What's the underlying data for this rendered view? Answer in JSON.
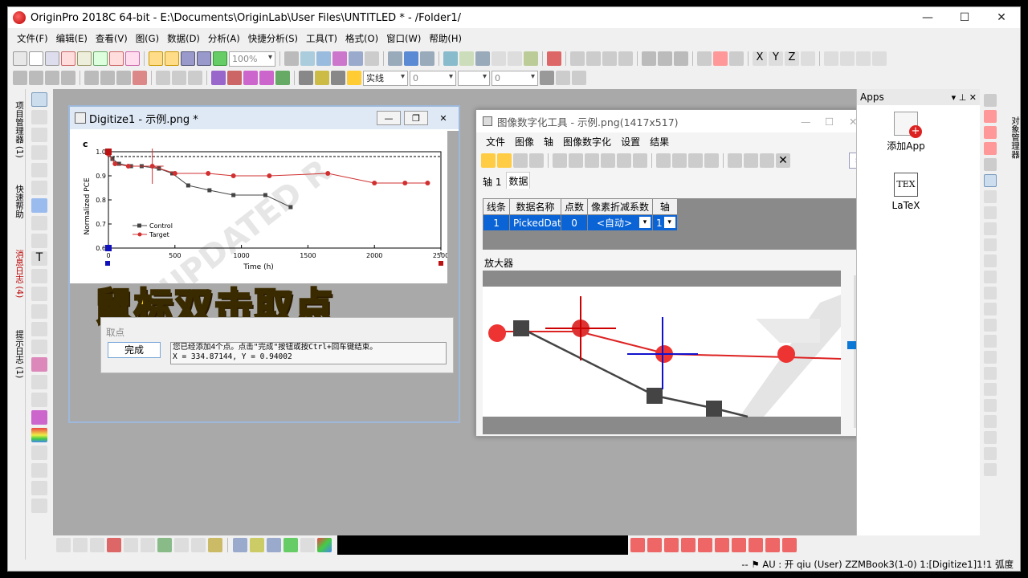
{
  "window": {
    "title": "OriginPro 2018C 64-bit - E:\\Documents\\OriginLab\\User Files\\UNTITLED * - /Folder1/",
    "minimize": "—",
    "maximize": "☐",
    "close": "✕"
  },
  "menu": [
    "文件(F)",
    "编辑(E)",
    "查看(V)",
    "图(G)",
    "数据(D)",
    "分析(A)",
    "快捷分析(S)",
    "工具(T)",
    "格式(O)",
    "窗口(W)",
    "帮助(H)"
  ],
  "toolbar": {
    "zoom_value": "100%",
    "line_style": "实线",
    "line_width": "0",
    "font_size": "0"
  },
  "left_dock": {
    "tabs": [
      "项目管理器 (1)",
      "快速帮助",
      "消息日志 (4)",
      "提示日志 (1)"
    ]
  },
  "right_dock": {
    "tab": "对象管理器"
  },
  "digitize_window": {
    "title": "Digitize1 - 示例.png *",
    "pick_section": "取点",
    "done_button": "完成",
    "message_line1": "您已经添加4个点。点击\"完成\"按钮或按Ctrl+回车键结束。",
    "message_line2": "X = 334.87144, Y = 0.94002",
    "watermark": "UPDATED R",
    "chart_data": {
      "type": "line",
      "panel_label": "c",
      "xlabel": "Time (h)",
      "ylabel": "Normalized PCE",
      "xlim": [
        0,
        2500
      ],
      "ylim": [
        0.6,
        1.0
      ],
      "x_ticks": [
        "0",
        "500",
        "1000",
        "1500",
        "2000",
        "2500"
      ],
      "y_ticks": [
        "0.6",
        "0.7",
        "0.8",
        "0.9",
        "1.0"
      ],
      "series": [
        {
          "name": "Control",
          "color": "#444444",
          "x": [
            0,
            30,
            80,
            170,
            250,
            380,
            480,
            600,
            760,
            940,
            1180,
            1370
          ],
          "y": [
            1.0,
            0.97,
            0.95,
            0.94,
            0.94,
            0.93,
            0.91,
            0.86,
            0.84,
            0.82,
            0.82,
            0.77
          ]
        },
        {
          "name": "Target",
          "color": "#d03030",
          "x": [
            0,
            50,
            150,
            330,
            500,
            750,
            940,
            1210,
            1650,
            2000,
            2230,
            2400
          ],
          "y": [
            0.99,
            0.95,
            0.94,
            0.94,
            0.91,
            0.91,
            0.9,
            0.9,
            0.91,
            0.87,
            0.87,
            0.87
          ]
        }
      ]
    }
  },
  "overlay_text": "鼠标双击取点",
  "digitizer_tool": {
    "title": "图像数字化工具 - 示例.png(1417x517)",
    "menu": [
      "文件",
      "图像",
      "轴",
      "图像数字化",
      "设置",
      "结果"
    ],
    "tabs": [
      "轴 1",
      "数据"
    ],
    "table_headers": [
      "线条",
      "数据名称",
      "点数",
      "像素折减系数",
      "轴"
    ],
    "table_row": [
      "1",
      "PickedData",
      "0",
      "<自动>",
      "1"
    ],
    "magnifier_label": "放大器"
  },
  "apps_panel": {
    "title": "Apps",
    "items": [
      "添加App",
      "LaTeX"
    ],
    "latex_icon": "TEX"
  },
  "status": {
    "text": "-- ⚑ AU : 开 qiu (User) ZZMBook3(1-0) 1:[Digitize1]1!1 弧度"
  }
}
